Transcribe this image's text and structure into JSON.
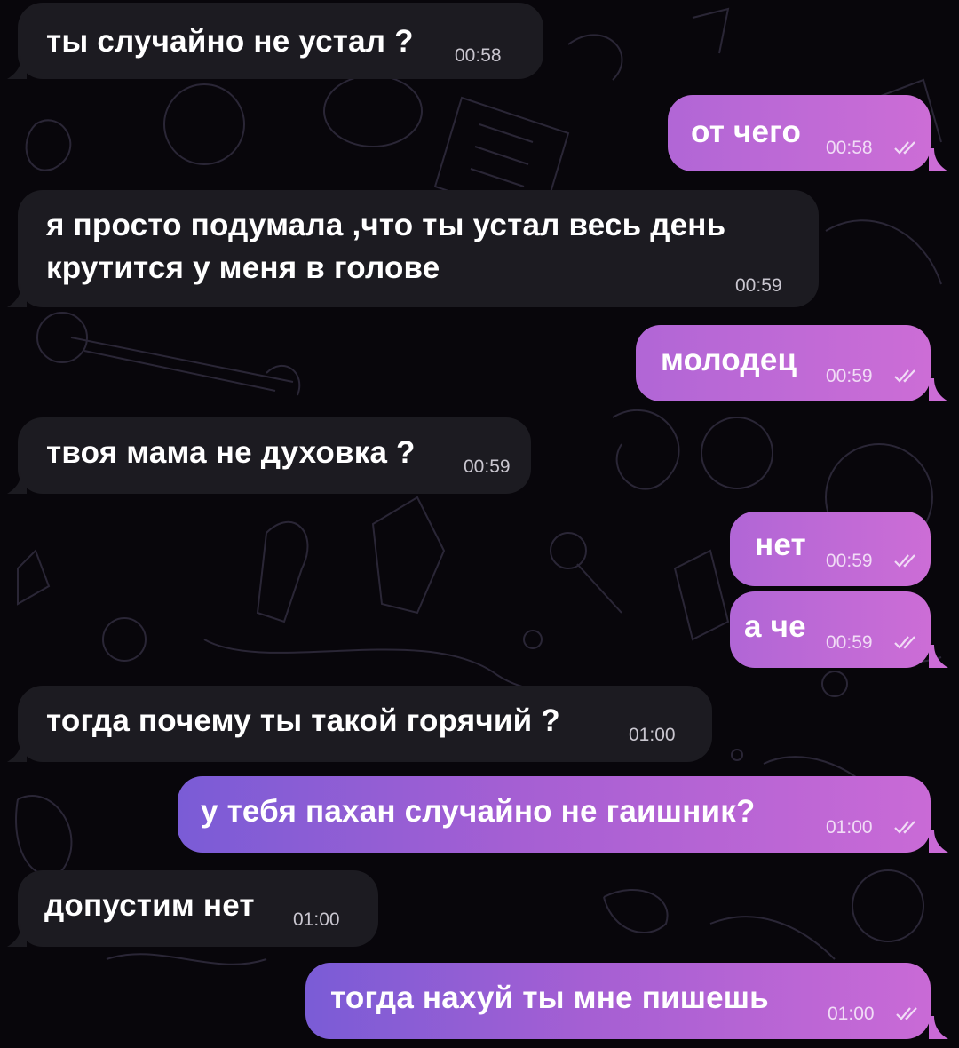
{
  "messages": [
    {
      "side": "in",
      "text": "ты случайно не устал ?",
      "time": "00:58"
    },
    {
      "side": "out",
      "text": "от чего",
      "time": "00:58",
      "status": "read-double-check-icon"
    },
    {
      "side": "in",
      "text": "я просто подумала ,что ты устал весь день",
      "text2": "крутится у меня в голове",
      "time": "00:59"
    },
    {
      "side": "out",
      "text": "молодец",
      "time": "00:59",
      "status": "read-double-check-icon"
    },
    {
      "side": "in",
      "text": "твоя мама не духовка ?",
      "time": "00:59"
    },
    {
      "side": "out",
      "text": "нет",
      "time": "00:59",
      "status": "read-double-check-icon"
    },
    {
      "side": "out",
      "text": "а че",
      "time": "00:59",
      "status": "read-double-check-icon"
    },
    {
      "side": "in",
      "text": "тогда почему ты такой горячий ?",
      "time": "01:00"
    },
    {
      "side": "out",
      "text": "у тебя пахан случайно не гаишник?",
      "time": "01:00",
      "status": "read-double-check-icon"
    },
    {
      "side": "in",
      "text": "допустим нет",
      "time": "01:00"
    },
    {
      "side": "out",
      "text": "тогда нахуй ты мне пишешь",
      "time": "01:00",
      "status": "read-double-check-icon"
    }
  ],
  "colors": {
    "background": "#08060b",
    "incoming": "#1c1b21",
    "outgoing_start": "#7a5cd6",
    "outgoing_end": "#c96ad6"
  }
}
